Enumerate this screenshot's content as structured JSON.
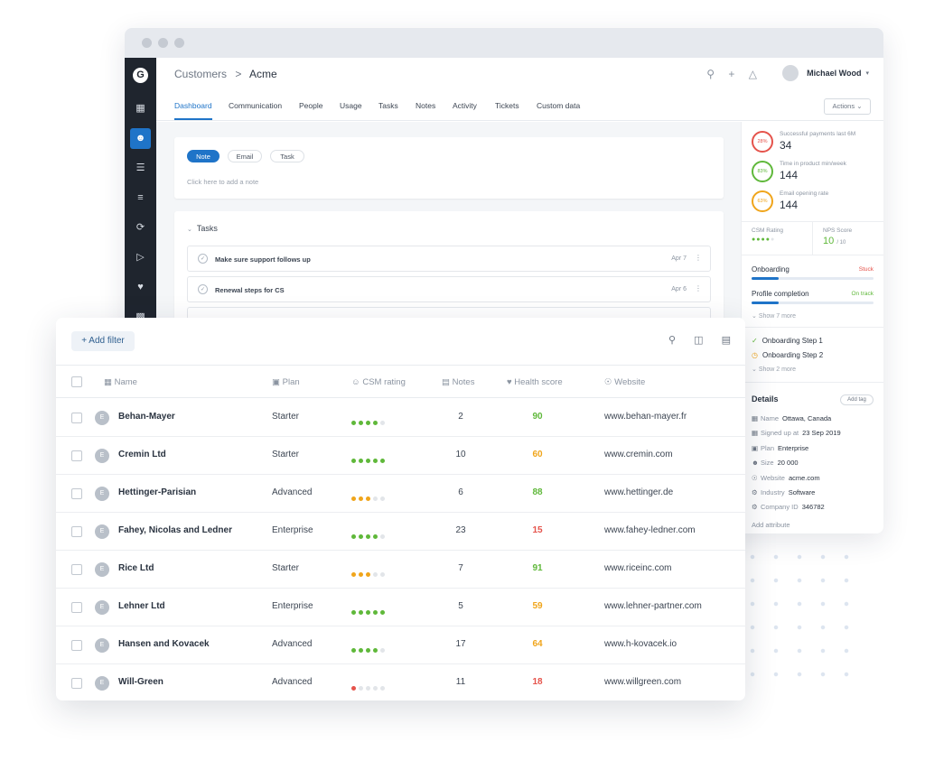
{
  "colors": {
    "accent": "#1f74c8",
    "good": "#5fb83a",
    "warn": "#f0a51b",
    "bad": "#e5534b",
    "dim": "#e2e5e9"
  },
  "rail": {
    "logo": "G",
    "icons": [
      "grid-icon",
      "users-icon",
      "list-icon",
      "tree-icon",
      "sync-icon",
      "export-icon",
      "heart-icon",
      "card-icon"
    ],
    "active_index": 1
  },
  "header": {
    "crumb_parent": "Customers",
    "separator": ">",
    "crumb_current": "Acme",
    "user": "Michael Wood"
  },
  "tabs": [
    "Dashboard",
    "Communication",
    "People",
    "Usage",
    "Tasks",
    "Notes",
    "Activity",
    "Tickets",
    "Custom data"
  ],
  "actions_label": "Actions",
  "note_card": {
    "pills": [
      "Note",
      "Email",
      "Task"
    ],
    "hint": "Click here to add a note"
  },
  "tasks_card": {
    "title": "Tasks",
    "items": [
      {
        "title": "Make sure support follows up",
        "date": "Apr 7"
      },
      {
        "title": "Renewal steps for CS",
        "date": "Apr 6"
      }
    ]
  },
  "metrics": [
    {
      "pct": "28%",
      "label": "Successful payments last 6M",
      "value": "34"
    },
    {
      "pct": "83%",
      "label": "Time in product min/week",
      "value": "144"
    },
    {
      "pct": "63%",
      "label": "Email opening rate",
      "value": "144"
    }
  ],
  "csm_rating_label": "CSM Rating",
  "csm_rating_value": 4,
  "nps_label": "NPS Score",
  "nps_value": "10",
  "nps_max": "/ 10",
  "progress": [
    {
      "label": "Onboarding",
      "status": "Stuck",
      "fraction": 0.22
    },
    {
      "label": "Profile completion",
      "status": "On track",
      "fraction": 0.22
    }
  ],
  "show_more_1": "Show 7 more",
  "steps": [
    {
      "label": "Onboarding Step 1",
      "state": "done"
    },
    {
      "label": "Onboarding Step 2",
      "state": "pending"
    }
  ],
  "show_more_2": "Show 2 more",
  "details": {
    "title": "Details",
    "add_tag": "Add tag",
    "rows": [
      {
        "key": "Name",
        "value": "Ottawa, Canada"
      },
      {
        "key": "Signed up at",
        "value": "23 Sep 2019"
      },
      {
        "key": "Plan",
        "value": "Enterprise"
      },
      {
        "key": "Size",
        "value": "20 000"
      },
      {
        "key": "Website",
        "value": "acme.com"
      },
      {
        "key": "Industry",
        "value": "Software"
      },
      {
        "key": "Company ID",
        "value": "346782"
      }
    ],
    "add_attribute": "Add attribute"
  },
  "table": {
    "add_filter": "+ Add filter",
    "columns": [
      "Name",
      "Plan",
      "CSM rating",
      "Notes",
      "Health score",
      "Website"
    ],
    "rows": [
      {
        "badge": "E",
        "name": "Behan-Mayer",
        "plan": "Starter",
        "rating": 4,
        "notes": "2",
        "health": "90",
        "site": "www.behan-mayer.fr"
      },
      {
        "badge": "E",
        "name": "Cremin Ltd",
        "plan": "Starter",
        "rating": 5,
        "notes": "10",
        "health": "60",
        "site": "www.cremin.com"
      },
      {
        "badge": "E",
        "name": "Hettinger-Parisian",
        "plan": "Advanced",
        "rating": 3,
        "notes": "6",
        "health": "88",
        "site": "www.hettinger.de"
      },
      {
        "badge": "E",
        "name": "Fahey, Nicolas and Ledner",
        "plan": "Enterprise",
        "rating": 4,
        "notes": "23",
        "health": "15",
        "site": "www.fahey-ledner.com"
      },
      {
        "badge": "E",
        "name": "Rice Ltd",
        "plan": "Starter",
        "rating": 3,
        "notes": "7",
        "health": "91",
        "site": "www.riceinc.com"
      },
      {
        "badge": "E",
        "name": "Lehner Ltd",
        "plan": "Enterprise",
        "rating": 5,
        "notes": "5",
        "health": "59",
        "site": "www.lehner-partner.com"
      },
      {
        "badge": "E",
        "name": "Hansen and Kovacek",
        "plan": "Advanced",
        "rating": 4,
        "notes": "17",
        "health": "64",
        "site": "www.h-kovacek.io"
      },
      {
        "badge": "E",
        "name": "Will-Green",
        "plan": "Advanced",
        "rating": 1,
        "notes": "11",
        "health": "18",
        "site": "www.willgreen.com"
      }
    ]
  }
}
